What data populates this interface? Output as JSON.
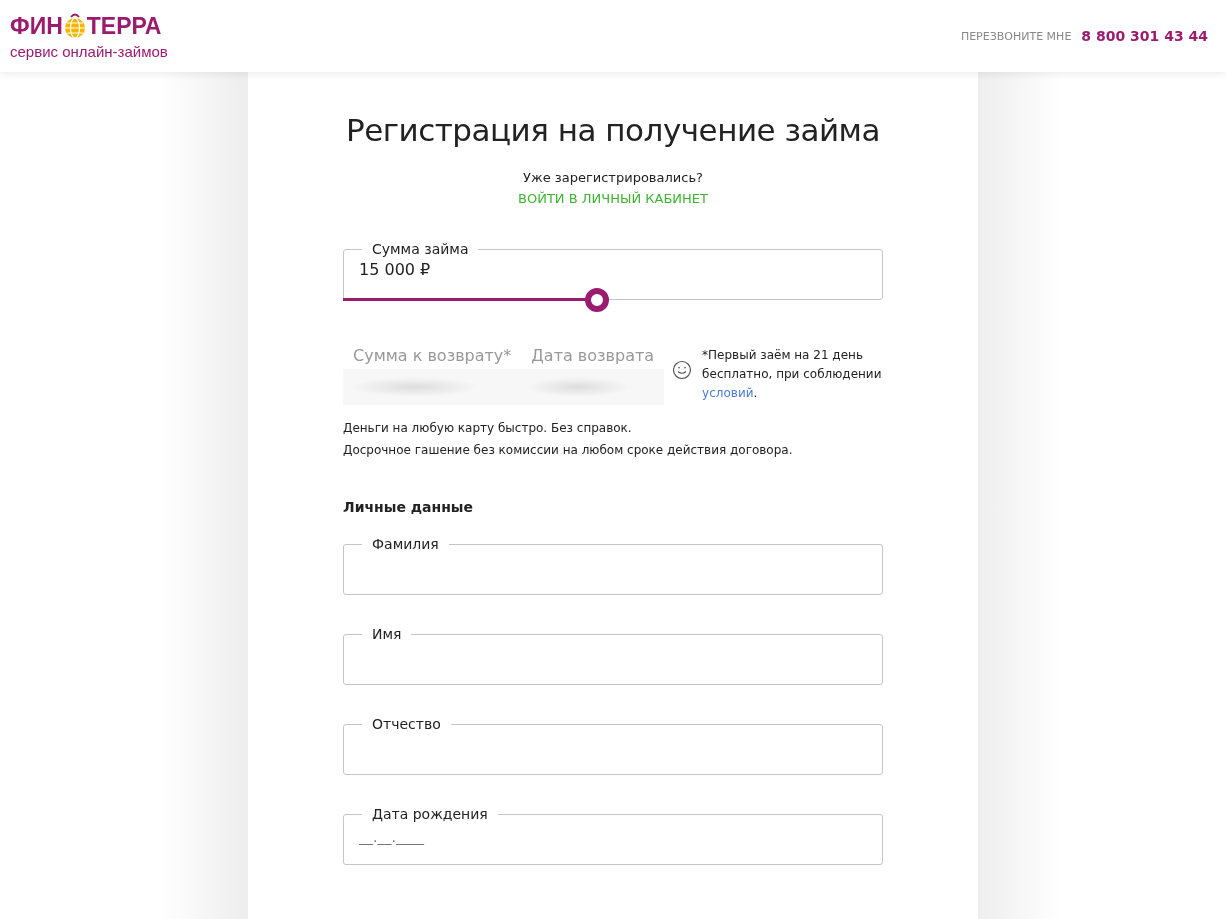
{
  "header": {
    "brand_left": "ФИН",
    "brand_right": "ТЕРРА",
    "tagline": "сервис онлайн-займов",
    "callback_label": "ПЕРЕЗВОНИТЕ МНЕ",
    "phone": "8 800 301 43 44"
  },
  "form": {
    "title": "Регистрация на получение займа",
    "registered_question": "Уже зарегистрировались?",
    "login_link": "ВОЙТИ В ЛИЧНЫЙ КАБИНЕТ",
    "loan_amount": {
      "label": "Сумма займа",
      "value": "15 000 ₽",
      "level": 0.47
    },
    "summary": [
      {
        "label": "Сумма к возврату*"
      },
      {
        "label": "Дата возврата"
      }
    ],
    "note": {
      "text": "*Первый заём на 21 день бесплатно, при соблюдении",
      "link": "условий",
      "after": "."
    },
    "benefits": [
      "Деньги на любую карту быстро. Без справок.",
      "Досрочное гашение без комиссии на любом сроке действия договора."
    ],
    "section_title": "Личные данные",
    "fields": [
      {
        "label": "Фамилия"
      },
      {
        "label": "Имя"
      },
      {
        "label": "Отчество"
      },
      {
        "label": "Дата рождения",
        "placeholder": "__.__.____"
      }
    ]
  }
}
